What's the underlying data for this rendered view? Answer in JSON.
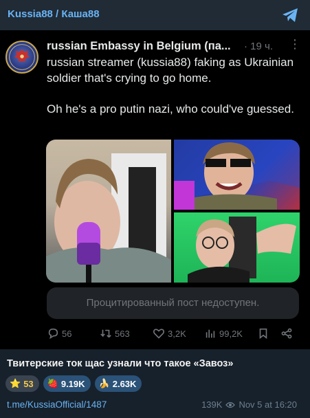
{
  "channel": {
    "title": "Kussia88 / Каша88"
  },
  "tweet": {
    "author": "russian Embassy in Belgium (па...",
    "time": "· 19 ч.",
    "more": "⋮",
    "paragraphs": [
      "russian streamer (kussia88) faking as Ukrainian soldier that's crying to go home.",
      "Oh he's a pro putin nazi, who could've guessed."
    ],
    "quote_unavailable": "Процитированный пост недоступен.",
    "actions": {
      "replies": "56",
      "reposts": "563",
      "likes": "3,2K",
      "views": "99,2K"
    }
  },
  "post": {
    "caption": "Твитерские ток щас узнали что такое «Завоз»",
    "reactions": [
      {
        "emoji": "⭐",
        "count": "53"
      },
      {
        "emoji": "🍓",
        "count": "9.19K"
      },
      {
        "emoji": "🍌",
        "count": "2.63K"
      }
    ],
    "link": "t.me/KussiaOfficial/1487",
    "views": "139K",
    "date": "Nov 5 at 16:20"
  },
  "colors": {
    "accent": "#6ab3f3",
    "background": "#17212b",
    "tweet_background": "#000000",
    "reaction_bg": "#2b5278"
  }
}
